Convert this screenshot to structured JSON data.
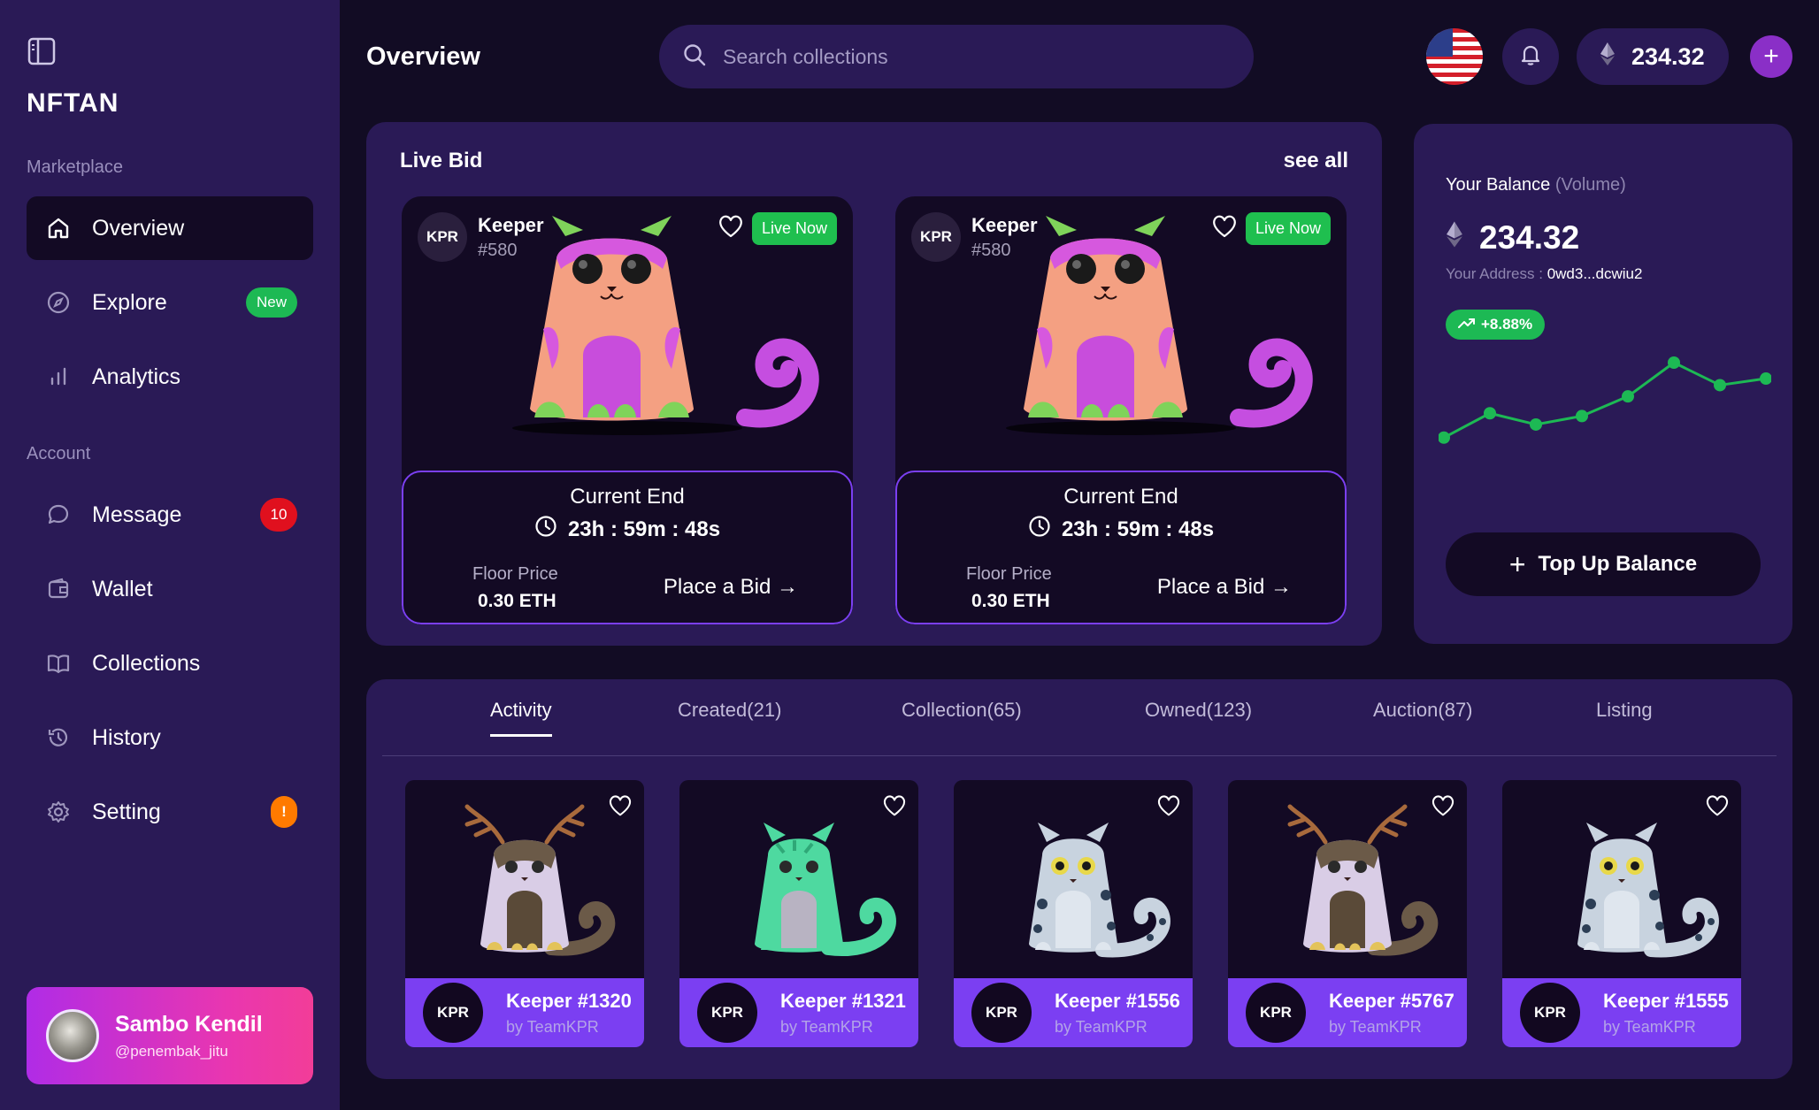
{
  "app": {
    "name": "NFTAN",
    "page_title": "Overview"
  },
  "sidebar": {
    "sections": {
      "marketplace": "Marketplace",
      "account": "Account"
    },
    "marketplace_items": [
      {
        "label": "Overview",
        "icon": "home-icon",
        "active": true
      },
      {
        "label": "Explore",
        "icon": "compass-icon",
        "badge": "New"
      },
      {
        "label": "Analytics",
        "icon": "bar-chart-icon"
      }
    ],
    "account_items": [
      {
        "label": "Message",
        "icon": "chat-icon",
        "badge": "10"
      },
      {
        "label": "Wallet",
        "icon": "wallet-icon"
      },
      {
        "label": "Collections",
        "icon": "book-icon"
      },
      {
        "label": "History",
        "icon": "history-icon"
      },
      {
        "label": "Setting",
        "icon": "gear-icon",
        "badge": "!"
      }
    ],
    "profile": {
      "name": "Sambo Kendil",
      "handle": "@penembak_jitu"
    }
  },
  "topbar": {
    "search_placeholder": "Search collections",
    "balance": "234.32"
  },
  "live_bid": {
    "title": "Live Bid",
    "see_all": "see all",
    "cards": [
      {
        "chip": "KPR",
        "name": "Keeper",
        "number": "#580",
        "status": "Live Now",
        "current_end_label": "Current End",
        "timer": "23h : 59m : 48s",
        "floor_label": "Floor Price",
        "floor_value": "0.30 ETH",
        "cta": "Place a Bid →"
      },
      {
        "chip": "KPR",
        "name": "Keeper",
        "number": "#580",
        "status": "Live Now",
        "current_end_label": "Current End",
        "timer": "23h : 59m : 48s",
        "floor_label": "Floor Price",
        "floor_value": "0.30 ETH",
        "cta": "Place a Bid →"
      }
    ]
  },
  "balance_card": {
    "label": "Your Balance",
    "label_suffix": "(Volume)",
    "amount": "234.32",
    "address_label": "Your Address :",
    "address": "0wd3...dcwiu2",
    "trend": "+8.88%",
    "sparkline": [
      0.2,
      0.46,
      0.34,
      0.43,
      0.64,
      1.0,
      0.76,
      0.83
    ],
    "cta": "Top Up Balance"
  },
  "activity": {
    "tabs": [
      "Activity",
      "Created(21)",
      "Collection(65)",
      "Owned(123)",
      "Auction(87)",
      "Listing"
    ],
    "active_tab": "Activity",
    "items": [
      {
        "chip": "KPR",
        "title": "Keeper #1320",
        "by": "by TeamKPR",
        "art": "antler-cat"
      },
      {
        "chip": "KPR",
        "title": "Keeper #1321",
        "by": "by TeamKPR",
        "art": "green-cat"
      },
      {
        "chip": "KPR",
        "title": "Keeper #1556",
        "by": "by TeamKPR",
        "art": "spotted-cat"
      },
      {
        "chip": "KPR",
        "title": "Keeper #5767",
        "by": "by TeamKPR",
        "art": "antler-cat"
      },
      {
        "chip": "KPR",
        "title": "Keeper #1555",
        "by": "by TeamKPR",
        "art": "spotted-cat"
      }
    ]
  },
  "colors": {
    "sidebar": "#2a1a56",
    "background": "#120c24",
    "accent_purple": "#7b3ff2",
    "live_green": "#1fbf4f",
    "trend_green": "#1db954",
    "badge_red": "#e0101e",
    "badge_orange": "#ff7a00"
  }
}
